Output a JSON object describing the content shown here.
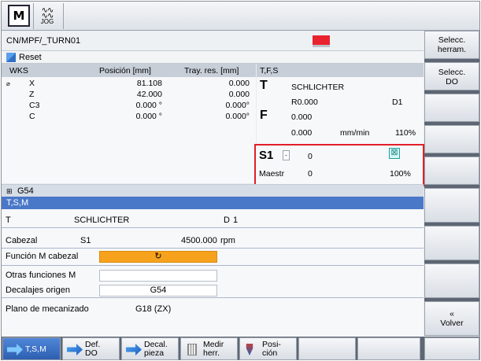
{
  "header": {
    "mode_icon_label": "M",
    "jog_icon_label": "JOG",
    "icons": [
      "machine-mode-icon",
      "jog-icon"
    ]
  },
  "program": {
    "path": "CN/MPF/_TURN01",
    "status": "Reset",
    "alarm_color": "#e8232f"
  },
  "wks": {
    "title": "WKS",
    "col_pos": "Posición [mm]",
    "col_dtg": "Tray. res. [mm]",
    "axes": [
      {
        "mark": "⌀",
        "name": "X",
        "pos": "81.108",
        "dtg": "0.000"
      },
      {
        "mark": "",
        "name": "Z",
        "pos": "42.000",
        "dtg": "0.000"
      },
      {
        "mark": "",
        "name": "C3",
        "pos": "0.000 °",
        "dtg": "0.000°"
      },
      {
        "mark": "",
        "name": "C",
        "pos": "0.000 °",
        "dtg": "0.000°"
      }
    ]
  },
  "tfs": {
    "title": "T,F,S",
    "t_letter": "T",
    "tool_name": "SCHLICHTER",
    "tool_r": "R0.000",
    "tool_d": "D1",
    "f_letter": "F",
    "feed": "0.000",
    "feed_cut": "0.000",
    "feed_unit": "mm/min",
    "feed_pct": "110%"
  },
  "spindle": {
    "name": "S1",
    "dropdown": "-",
    "speed": "0",
    "master_label": "Maestr",
    "master_value": "0",
    "override": "100%",
    "icon": "spindle-stop-icon"
  },
  "work_offset": {
    "label": "G54"
  },
  "tsm": {
    "title": "T,S,M",
    "tool_key": "T",
    "tool_value": "SCHLICHTER",
    "tool_d": "D",
    "tool_d_value": "1",
    "spindle_key": "Cabezal",
    "spindle_value": "S1",
    "spindle_speed": "4500.000",
    "spindle_unit": "rpm",
    "mfunc_key": "Función M cabezal",
    "mfunc_value": "↻",
    "other_m_key": "Otras funciones M",
    "other_m_value": "",
    "offset_key": "Decalajes origen",
    "offset_value": "G54",
    "plane_key": "Plano de mecanizado",
    "plane_value": "G18 (ZX)",
    "accent": "#f7a21c"
  },
  "scroll": {
    "arrow": ">"
  },
  "right_softkeys": [
    {
      "label": "Selecc.\nherram."
    },
    {
      "label": "Selecc.\nDO"
    },
    {
      "label": ""
    },
    {
      "label": ""
    },
    {
      "label": ""
    },
    {
      "label": ""
    },
    {
      "label": ""
    },
    {
      "label": "«\nVolver"
    }
  ],
  "bottom_softkeys": [
    {
      "label": "T,S,M"
    },
    {
      "label": "Def.\nDO"
    },
    {
      "label": "Decal.\npieza"
    },
    {
      "label": "Medir\nherr."
    },
    {
      "label": "Posi-\nción"
    },
    {
      "label": ""
    },
    {
      "label": ""
    },
    {
      "label": ""
    }
  ]
}
